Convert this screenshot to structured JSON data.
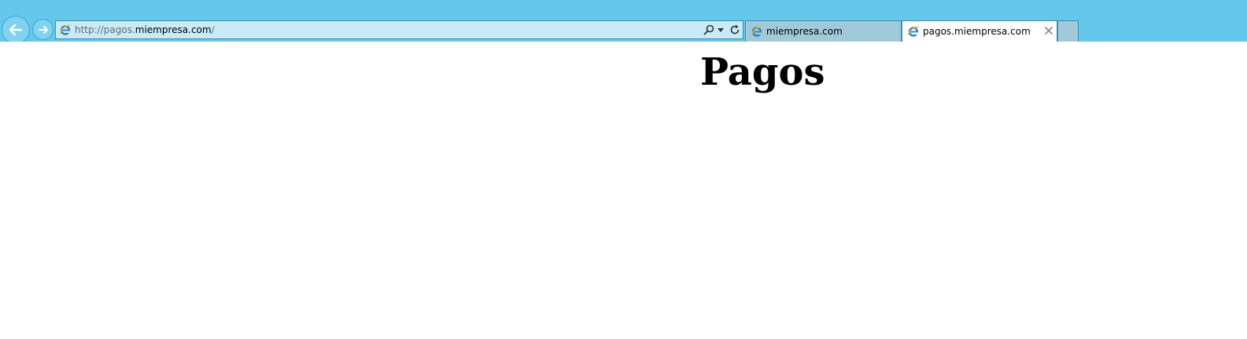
{
  "browser": {
    "toolbar_color": "#64c8eb",
    "address_bar_color": "#c9ebf7",
    "inactive_tab_color": "#a0cad9",
    "back_icon": "back-arrow-icon",
    "forward_icon": "forward-arrow-icon",
    "address": {
      "scheme": "http://",
      "subdomain": "pagos.",
      "domain": "miempresa.com",
      "path": "/",
      "site_icon": "ie-icon",
      "search_icon": "search-icon",
      "dropdown_icon": "dropdown-arrow-icon",
      "refresh_icon": "refresh-icon"
    },
    "tabs": [
      {
        "label": "miempresa.com",
        "active": false,
        "icon": "ie-icon"
      },
      {
        "label": "pagos.miempresa.com",
        "active": true,
        "icon": "ie-icon",
        "close_icon": "close-icon"
      }
    ]
  },
  "page": {
    "heading": "Pagos"
  }
}
